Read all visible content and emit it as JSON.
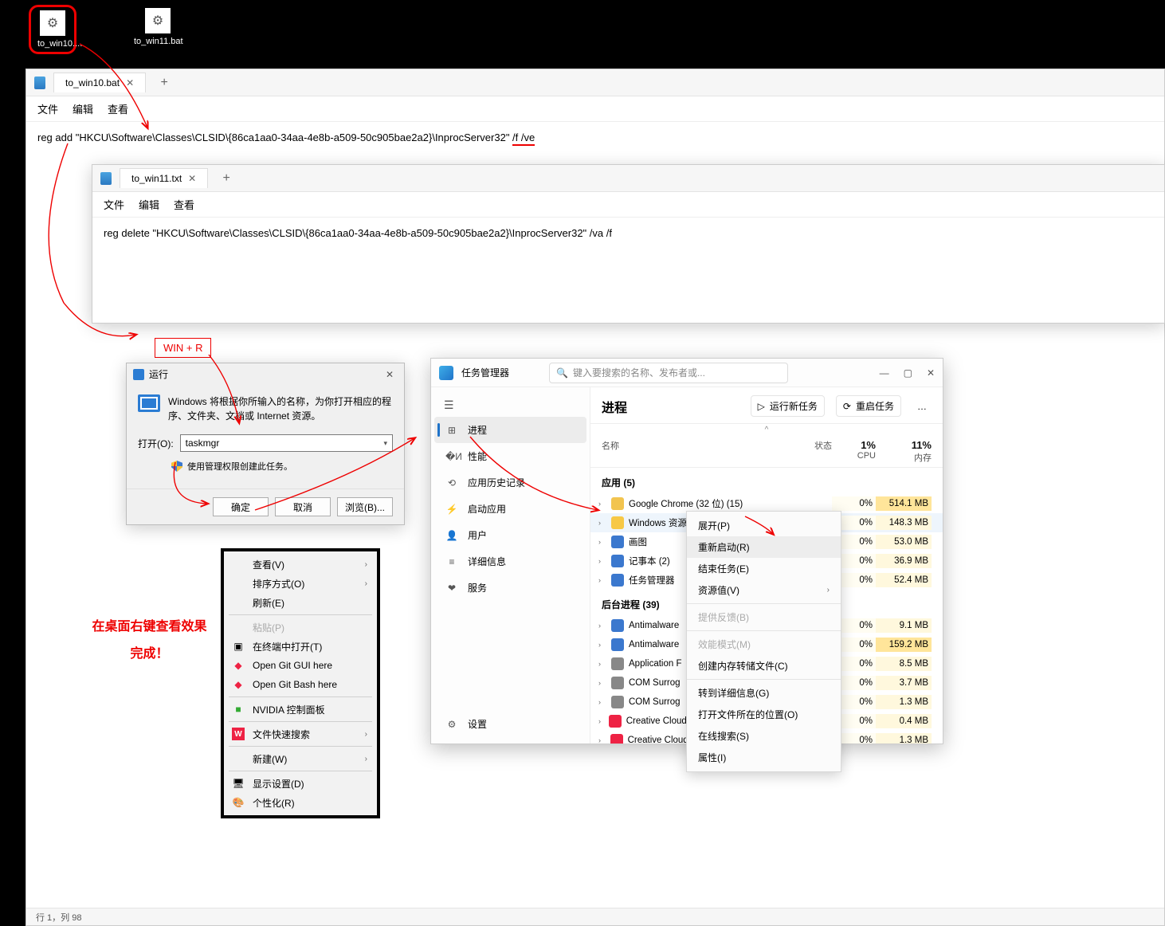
{
  "desktop": {
    "icons": [
      {
        "label": "to_win10....",
        "circled": true
      },
      {
        "label": "to_win11.bat",
        "circled": false
      }
    ]
  },
  "notepad1": {
    "tab_title": "to_win10.bat",
    "menu": {
      "file": "文件",
      "edit": "编辑",
      "view": "查看"
    },
    "content_plain": "reg add \"HKCU\\Software\\Classes\\CLSID\\{86ca1aa0-34aa-4e8b-a509-50c905bae2a2}\\InprocServer32\" ",
    "content_underlined": "/f /ve",
    "statusbar": "行 1，列 98"
  },
  "notepad2": {
    "tab_title": "to_win11.txt",
    "menu": {
      "file": "文件",
      "edit": "编辑",
      "view": "查看"
    },
    "content": "reg delete \"HKCU\\Software\\Classes\\CLSID\\{86ca1aa0-34aa-4e8b-a509-50c905bae2a2}\\InprocServer32\" /va /f"
  },
  "annotations": {
    "win_r": "WIN + R",
    "desktop_effect_l1": "在桌面右键查看效果",
    "desktop_effect_l2": "完成！"
  },
  "run_dialog": {
    "title": "运行",
    "desc": "Windows 将根据你所输入的名称，为你打开相应的程序、文件夹、文档或 Internet 资源。",
    "open_label": "打开(O):",
    "open_value": "taskmgr",
    "admin_text": "使用管理权限创建此任务。",
    "ok": "确定",
    "cancel": "取消",
    "browse": "浏览(B)..."
  },
  "desktop_ctx": {
    "items": [
      {
        "label": "查看(V)",
        "submenu": true
      },
      {
        "label": "排序方式(O)",
        "submenu": true
      },
      {
        "label": "刷新(E)"
      },
      {
        "sep": true
      },
      {
        "label": "粘贴(P)",
        "disabled": true
      },
      {
        "label": "在终端中打开(T)",
        "icon": "terminal"
      },
      {
        "label": "Open Git GUI here",
        "icon": "git"
      },
      {
        "label": "Open Git Bash here",
        "icon": "git"
      },
      {
        "sep": true
      },
      {
        "label": "NVIDIA 控制面板",
        "icon": "nvidia"
      },
      {
        "sep": true
      },
      {
        "label": "文件快速搜索",
        "icon": "search",
        "submenu": true
      },
      {
        "sep": true
      },
      {
        "label": "新建(W)",
        "submenu": true
      },
      {
        "sep": true
      },
      {
        "label": "显示设置(D)",
        "icon": "display"
      },
      {
        "label": "个性化(R)",
        "icon": "personalize"
      }
    ]
  },
  "taskmgr": {
    "title": "任务管理器",
    "search_placeholder": "键入要搜索的名称、发布者或...",
    "sidebar": {
      "items": [
        {
          "icon": "⊞",
          "label": "进程",
          "active": true
        },
        {
          "icon": "�И",
          "label": "性能"
        },
        {
          "icon": "⟲",
          "label": "应用历史记录"
        },
        {
          "icon": "⚡",
          "label": "启动应用"
        },
        {
          "icon": "👤",
          "label": "用户"
        },
        {
          "icon": "≡",
          "label": "详细信息"
        },
        {
          "icon": "❤",
          "label": "服务"
        }
      ],
      "settings": {
        "icon": "⚙",
        "label": "设置"
      }
    },
    "proc_header": {
      "title": "进程",
      "run_new": "运行新任务",
      "restart": "重启任务",
      "more": "…"
    },
    "columns": {
      "name": "名称",
      "status": "状态",
      "cpu_pct": "1%",
      "cpu_label": "CPU",
      "mem_pct": "11%",
      "mem_label": "内存"
    },
    "groups": {
      "apps": "应用 (5)",
      "bg": "后台进程 (39)"
    },
    "apps": [
      {
        "name": "Google Chrome (32 位) (15)",
        "cpu": "0%",
        "mem": "514.1 MB",
        "hot": true,
        "color": "#f2c44f"
      },
      {
        "name": "Windows 资源管理器 (2)",
        "cpu": "0%",
        "mem": "148.3 MB",
        "selected": true,
        "color": "#f7c845"
      },
      {
        "name": "画图",
        "cpu": "0%",
        "mem": "53.0 MB",
        "color": "#3b78ce"
      },
      {
        "name": "记事本 (2)",
        "cpu": "0%",
        "mem": "36.9 MB",
        "color": "#3b78ce"
      },
      {
        "name": "任务管理器",
        "cpu": "0%",
        "mem": "52.4 MB",
        "color": "#3b78ce"
      }
    ],
    "bg": [
      {
        "name": "Antimalware",
        "cpu": "0%",
        "mem": "9.1 MB",
        "color": "#3b78ce"
      },
      {
        "name": "Antimalware",
        "cpu": "0%",
        "mem": "159.2 MB",
        "hot": true,
        "color": "#3b78ce"
      },
      {
        "name": "Application F",
        "cpu": "0%",
        "mem": "8.5 MB",
        "color": "#888"
      },
      {
        "name": "COM Surrog",
        "cpu": "0%",
        "mem": "3.7 MB",
        "color": "#888"
      },
      {
        "name": "COM Surrog",
        "cpu": "0%",
        "mem": "1.3 MB",
        "color": "#888"
      },
      {
        "name": "Creative Cloud Content Ma...",
        "cpu": "0%",
        "mem": "0.4 MB",
        "color": "#e24"
      },
      {
        "name": "Creative Cloud Interproces...",
        "cpu": "0%",
        "mem": "1.3 MB",
        "color": "#e24"
      }
    ],
    "ctx": {
      "items": [
        {
          "label": "展开(P)"
        },
        {
          "label": "重新启动(R)",
          "hl": true
        },
        {
          "label": "结束任务(E)"
        },
        {
          "label": "资源值(V)",
          "submenu": true
        },
        {
          "sep": true
        },
        {
          "label": "提供反馈(B)",
          "disabled": true
        },
        {
          "sep": true
        },
        {
          "label": "效能模式(M)",
          "disabled": true
        },
        {
          "label": "创建内存转储文件(C)"
        },
        {
          "sep": true
        },
        {
          "label": "转到详细信息(G)"
        },
        {
          "label": "打开文件所在的位置(O)"
        },
        {
          "label": "在线搜索(S)"
        },
        {
          "label": "属性(I)"
        }
      ]
    }
  }
}
